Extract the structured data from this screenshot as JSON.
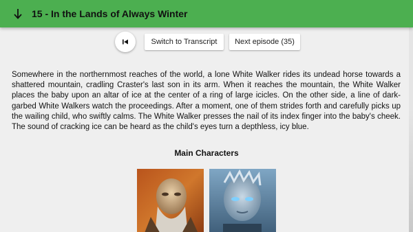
{
  "header": {
    "title": "15 - In the Lands of Always Winter",
    "background_color": "#4caf50"
  },
  "controls": {
    "transcript_label": "Switch to Transcript",
    "next_label": "Next episode (35)"
  },
  "summary": "Somewhere in the northernmost reaches of the world, a lone White Walker rides its undead horse towards a shattered mountain, cradling Craster's last son in its arm. When it reaches the mountain, the White Walker places the baby upon an altar of ice at the center of a ring of large icicles. On the other side, a line of dark-garbed White Walkers watch the proceedings. After a moment, one of them strides forth and carefully picks up the wailing child, who swiftly calms. The White Walker presses the nail of its index finger into the baby's cheek. The sound of cracking ice can be heard as the child's eyes turn a depthless, icy blue.",
  "characters": {
    "heading": "Main Characters"
  }
}
